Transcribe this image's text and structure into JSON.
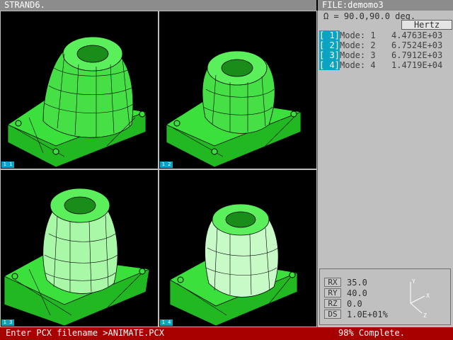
{
  "title_left": "STRAND6.",
  "title_right": "FILE:demomo3",
  "omega": "Ω = 90.0,90.0 deg.",
  "units_button": "Hertz",
  "modes": [
    {
      "tag": "[ 1]",
      "label": "Mode: 1",
      "value": "4.4763E+03"
    },
    {
      "tag": "[ 2]",
      "label": "Mode: 2",
      "value": "6.7524E+03"
    },
    {
      "tag": "[ 3]",
      "label": "Mode: 3",
      "value": "6.7912E+03"
    },
    {
      "tag": "[ 4]",
      "label": "Mode: 4",
      "value": "1.4719E+04"
    }
  ],
  "viewports": [
    {
      "tag": "1 1"
    },
    {
      "tag": "1 2"
    },
    {
      "tag": "1 3"
    },
    {
      "tag": "1 4"
    }
  ],
  "view": {
    "rx_label": "RX",
    "rx": "35.0",
    "ry_label": "RY",
    "ry": "40.0",
    "rz_label": "RZ",
    "rz": "0.0",
    "ds_label": "DS",
    "ds": "1.0E+01%",
    "axis_x": "X",
    "axis_y": "Y",
    "axis_z": "Z"
  },
  "status_prompt": "Enter PCX filename >ANIMATE.PCX",
  "status_progress": "98% Complete.",
  "colors": {
    "mesh_green": "#38d838",
    "status_red": "#a80000",
    "tag_blue": "#0aa3c2"
  }
}
